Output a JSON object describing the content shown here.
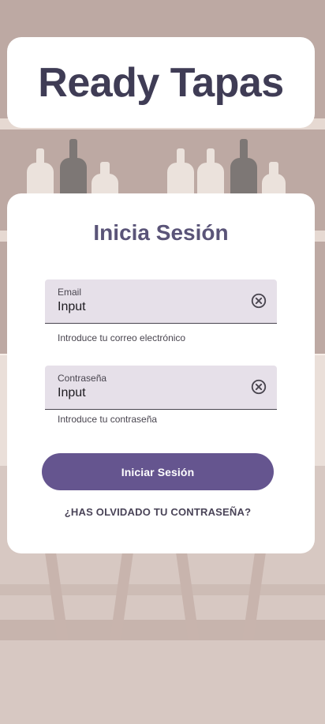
{
  "app": {
    "title": "Ready Tapas"
  },
  "login": {
    "heading": "Inicia Sesión",
    "email": {
      "label": "Email",
      "value": "Input",
      "helper": "Introduce tu correo electrónico",
      "clear_icon": "clear-circle-icon"
    },
    "password": {
      "label": "Contraseña",
      "value": "Input",
      "helper": "Introduce tu contraseña",
      "clear_icon": "clear-circle-icon"
    },
    "submit_label": "Iniciar Sesión",
    "forgot_label": "¿HAS OLVIDADO TU CONTRASEÑA?"
  },
  "colors": {
    "primary": "#65558f",
    "title": "#3f3c55",
    "heading": "#5a5478",
    "field_bg": "#e6e0e9"
  }
}
